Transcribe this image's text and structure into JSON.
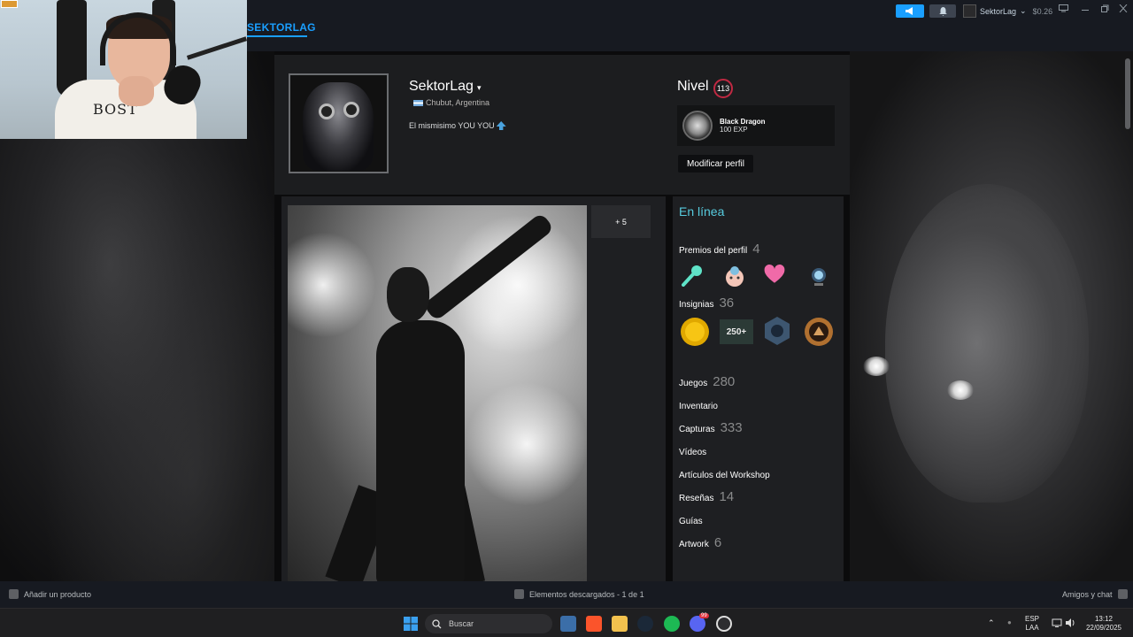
{
  "header": {
    "brand": "SEKTORLAG",
    "account_name": "SektorLag",
    "account_caret": "⌄",
    "balance": "$0.26",
    "icons": [
      "megaphone-icon",
      "bell-icon",
      "monitor-icon",
      "minimize-icon",
      "restore-icon",
      "close-icon"
    ]
  },
  "webcam": {
    "shirt_text": "BOST"
  },
  "profile": {
    "persona_name": "SektorLag",
    "persona_caret": "▾",
    "location": "Chubut, Argentina",
    "summary": "El mismisimo YOU YOU",
    "level_label": "Nivel",
    "level": "113",
    "favorite_badge": {
      "name": "Black Dragon",
      "xp": "100 EXP"
    },
    "edit_button": "Modificar perfil"
  },
  "showcase": {
    "more_screenshots": "+ 5"
  },
  "sidebar": {
    "status": "En línea",
    "awards_label": "Premios del perfil",
    "awards_count": "4",
    "badges_label": "Insignias",
    "badges_count": "36",
    "badge_250_text": "250+",
    "links": [
      {
        "label": "Juegos",
        "count": "280"
      },
      {
        "label": "Inventario",
        "count": ""
      },
      {
        "label": "Capturas",
        "count": "333"
      },
      {
        "label": "Vídeos",
        "count": ""
      },
      {
        "label": "Artículos del Workshop",
        "count": ""
      },
      {
        "label": "Reseñas",
        "count": "14"
      },
      {
        "label": "Guías",
        "count": ""
      },
      {
        "label": "Artwork",
        "count": "6"
      }
    ]
  },
  "footer": {
    "add_product": "Añadir un producto",
    "downloads": "Elementos descargados - 1 de 1",
    "friends_chat": "Amigos y chat"
  },
  "taskbar": {
    "search_placeholder": "Buscar",
    "lang_top": "ESP",
    "lang_bottom": "LAA",
    "time": "13:12",
    "date": "22/09/2025",
    "discord_badge": "99"
  },
  "colors": {
    "steam_blue": "#1a9fff",
    "online": "#57cbde",
    "level_ring": "#c02942",
    "header_bg": "#171a21"
  }
}
